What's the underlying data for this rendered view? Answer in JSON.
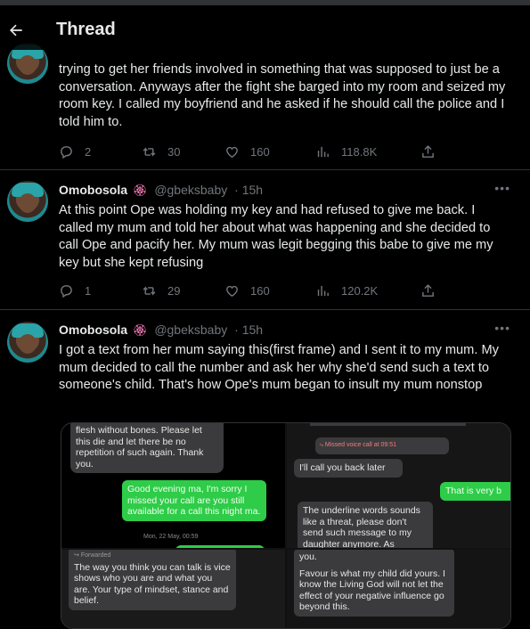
{
  "header": {
    "title": "Thread"
  },
  "tweets": [
    {
      "text": "trying to get her friends involved in something that was supposed to just be a conversation. Anyways after the fight she barged into my room and seized my room key. I called my boyfriend and he asked if he should call the police and I told him to.",
      "replies": "2",
      "retweets": "30",
      "likes": "160",
      "views": "118.8K"
    },
    {
      "name": "Omobosola",
      "badge": "🏵",
      "handle": "@gbeksbaby",
      "time": "· 15h",
      "text": "At this point Ope was holding my key and had refused to give me back. I called my mum and told her about what was happening and she decided to call Ope and pacify her. My mum was legit begging this babe to give me my key but she kept refusing",
      "replies": "1",
      "retweets": "29",
      "likes": "160",
      "views": "120.2K"
    },
    {
      "name": "Omobosola",
      "badge": "🏵",
      "handle": "@gbeksbaby",
      "time": "· 15h",
      "text": "I got a text from her mum saying this(first frame) and I sent it to my mum. My mum decided to call the number and ask her why she'd send such a text to someone's child. That's how Ope's mum began to insult my mum nonstop"
    }
  ],
  "media": {
    "img1": {
      "msg1": "flesh without bones. Please let this die and let there be no repetition of such again. Thank you.",
      "msg2": "Good evening ma, I'm sorry I missed your call are you still available for a call this night ma.",
      "date": "Mon, 22 May, 00:59"
    },
    "img2": {
      "missed": "Missed voice call at 09:51",
      "msg1": "I'll call you back later",
      "msg2": "That is very b",
      "msg3": "The underline words sounds like a threat, please don't send such message to my daughter anymore. As"
    },
    "img3": {
      "forwarded": "Forwarded",
      "msg1": "The way you think you can talk is vice shows who you are and what you are. Your type of mindset, stance and belief."
    },
    "img4": {
      "msg1": "you.",
      "msg2": "Favour is what my child did yours. I know the Living God will not let the effect of your negative influence go beyond this."
    }
  }
}
